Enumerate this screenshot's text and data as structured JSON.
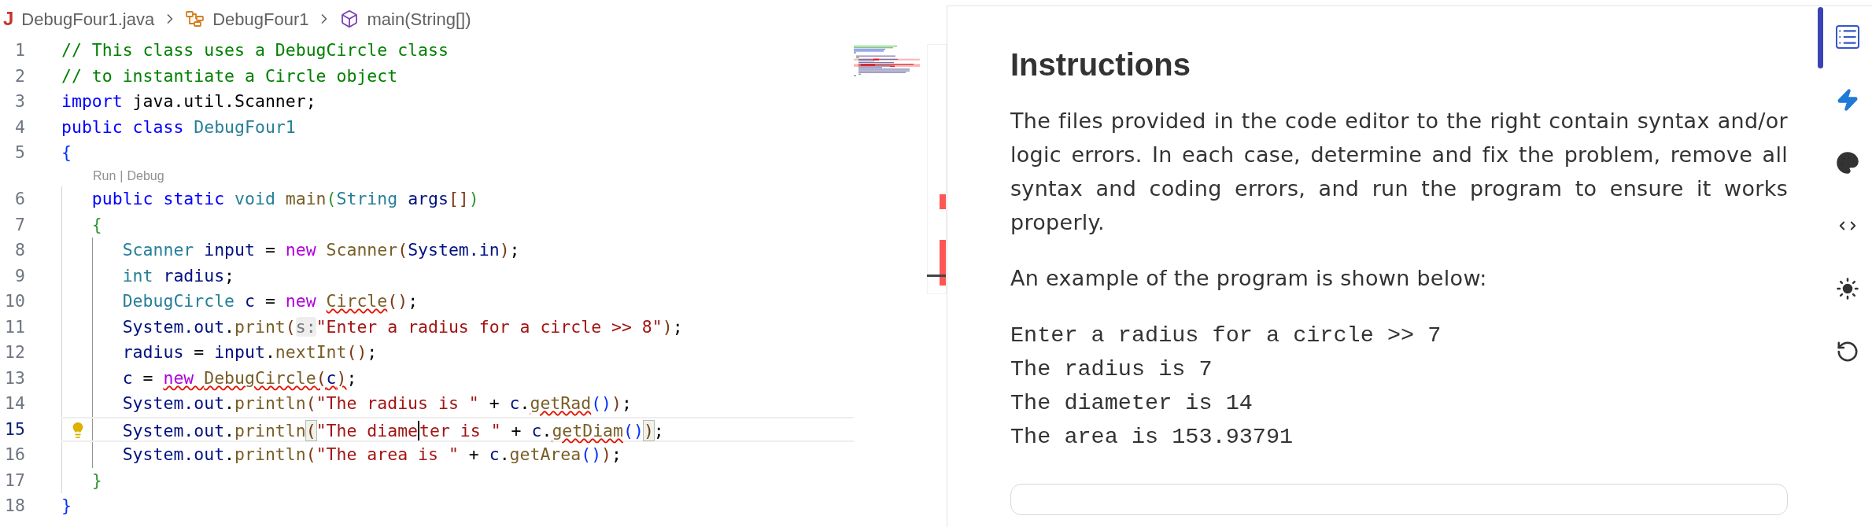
{
  "breadcrumb": [
    {
      "kind": "file",
      "icon_glyph": "J",
      "label": "DebugFour1.java"
    },
    {
      "kind": "class",
      "label": "DebugFour1"
    },
    {
      "kind": "method",
      "label": "main(String[])"
    }
  ],
  "editor": {
    "lines": [
      {
        "number": "1",
        "selected": false,
        "lightbulb": false,
        "tokens": [
          {
            "text": "// This class uses a DebugCircle class",
            "kind": "comment",
            "error": false,
            "matched": false,
            "caret": false
          }
        ]
      },
      {
        "number": "2",
        "selected": false,
        "lightbulb": false,
        "tokens": [
          {
            "text": "// to instantiate a Circle object",
            "kind": "comment",
            "error": false,
            "matched": false,
            "caret": false
          }
        ]
      },
      {
        "number": "3",
        "selected": false,
        "lightbulb": false,
        "tokens": [
          {
            "text": "import",
            "kind": "keyword",
            "error": false,
            "matched": false,
            "caret": false
          },
          {
            "text": " java.util.Scanner;",
            "kind": "plain",
            "error": false,
            "matched": false,
            "caret": false
          }
        ]
      },
      {
        "number": "4",
        "selected": false,
        "lightbulb": false,
        "tokens": [
          {
            "text": "public class ",
            "kind": "keyword",
            "error": false,
            "matched": false,
            "caret": false
          },
          {
            "text": "DebugFour1",
            "kind": "type",
            "error": false,
            "matched": false,
            "caret": false
          }
        ]
      },
      {
        "number": "5",
        "selected": false,
        "lightbulb": false,
        "tokens": [
          {
            "text": "{",
            "kind": "bracket1",
            "error": false,
            "matched": false,
            "caret": false
          }
        ]
      },
      {
        "number": "6",
        "selected": false,
        "lightbulb": false,
        "codelens": {
          "items": [
            "Run",
            "Debug"
          ],
          "separator": "|"
        },
        "tokens": [
          {
            "text": "   public static ",
            "kind": "keyword",
            "error": false,
            "matched": false,
            "caret": false
          },
          {
            "text": "void ",
            "kind": "type",
            "error": false,
            "matched": false,
            "caret": false
          },
          {
            "text": "main",
            "kind": "function",
            "error": false,
            "matched": false,
            "caret": false
          },
          {
            "text": "(",
            "kind": "bracket2",
            "error": false,
            "matched": false,
            "caret": false
          },
          {
            "text": "String ",
            "kind": "type",
            "error": false,
            "matched": false,
            "caret": false
          },
          {
            "text": "args",
            "kind": "variable",
            "error": false,
            "matched": false,
            "caret": false
          },
          {
            "text": "[]",
            "kind": "bracket3",
            "error": false,
            "matched": false,
            "caret": false
          },
          {
            "text": ")",
            "kind": "bracket2",
            "error": false,
            "matched": false,
            "caret": false
          }
        ]
      },
      {
        "number": "7",
        "selected": false,
        "lightbulb": false,
        "tokens": [
          {
            "text": "   {",
            "kind": "bracket2",
            "error": false,
            "matched": false,
            "caret": false
          }
        ]
      },
      {
        "number": "8",
        "selected": false,
        "lightbulb": false,
        "tokens": [
          {
            "text": "      Scanner ",
            "kind": "type",
            "error": false,
            "matched": false,
            "caret": false
          },
          {
            "text": "input",
            "kind": "variable",
            "error": false,
            "matched": false,
            "caret": false
          },
          {
            "text": " = ",
            "kind": "plain",
            "error": false,
            "matched": false,
            "caret": false
          },
          {
            "text": "new ",
            "kind": "control",
            "error": false,
            "matched": false,
            "caret": false
          },
          {
            "text": "Scanner",
            "kind": "function",
            "error": false,
            "matched": false,
            "caret": false
          },
          {
            "text": "(",
            "kind": "bracket3",
            "error": false,
            "matched": false,
            "caret": false
          },
          {
            "text": "System.in",
            "kind": "variable",
            "error": false,
            "matched": false,
            "caret": false
          },
          {
            "text": ")",
            "kind": "bracket3",
            "error": false,
            "matched": false,
            "caret": false
          },
          {
            "text": ";",
            "kind": "plain",
            "error": false,
            "matched": false,
            "caret": false
          }
        ]
      },
      {
        "number": "9",
        "selected": false,
        "lightbulb": false,
        "tokens": [
          {
            "text": "      int ",
            "kind": "type",
            "error": false,
            "matched": false,
            "caret": false
          },
          {
            "text": "radius",
            "kind": "variable",
            "error": false,
            "matched": false,
            "caret": false
          },
          {
            "text": ";",
            "kind": "plain",
            "error": false,
            "matched": false,
            "caret": false
          }
        ]
      },
      {
        "number": "10",
        "selected": false,
        "lightbulb": false,
        "tokens": [
          {
            "text": "      DebugCircle ",
            "kind": "type",
            "error": false,
            "matched": false,
            "caret": false
          },
          {
            "text": "c",
            "kind": "variable",
            "error": false,
            "matched": false,
            "caret": false
          },
          {
            "text": " = ",
            "kind": "plain",
            "error": false,
            "matched": false,
            "caret": false
          },
          {
            "text": "new ",
            "kind": "control",
            "error": false,
            "matched": false,
            "caret": false
          },
          {
            "text": "Circle",
            "kind": "function",
            "error": true,
            "matched": false,
            "caret": false
          },
          {
            "text": "()",
            "kind": "bracket3",
            "error": false,
            "matched": false,
            "caret": false
          },
          {
            "text": ";",
            "kind": "plain",
            "error": false,
            "matched": false,
            "caret": false
          }
        ]
      },
      {
        "number": "11",
        "selected": false,
        "lightbulb": false,
        "tokens": [
          {
            "text": "      System.out",
            "kind": "variable",
            "error": false,
            "matched": false,
            "caret": false
          },
          {
            "text": ".",
            "kind": "plain",
            "error": false,
            "matched": false,
            "caret": false
          },
          {
            "text": "print",
            "kind": "function",
            "error": false,
            "matched": false,
            "caret": false
          },
          {
            "text": "(",
            "kind": "bracket3",
            "error": false,
            "matched": false,
            "caret": false
          },
          {
            "text": "s:",
            "kind": "hint",
            "error": false,
            "matched": false,
            "caret": false
          },
          {
            "text": "\"Enter a radius for a circle >> 8\"",
            "kind": "string",
            "error": false,
            "matched": false,
            "caret": false
          },
          {
            "text": ")",
            "kind": "bracket3",
            "error": false,
            "matched": false,
            "caret": false
          },
          {
            "text": ";",
            "kind": "plain",
            "error": false,
            "matched": false,
            "caret": false
          }
        ]
      },
      {
        "number": "12",
        "selected": false,
        "lightbulb": false,
        "tokens": [
          {
            "text": "      radius",
            "kind": "variable",
            "error": false,
            "matched": false,
            "caret": false
          },
          {
            "text": " = ",
            "kind": "plain",
            "error": false,
            "matched": false,
            "caret": false
          },
          {
            "text": "input",
            "kind": "variable",
            "error": false,
            "matched": false,
            "caret": false
          },
          {
            "text": ".",
            "kind": "plain",
            "error": false,
            "matched": false,
            "caret": false
          },
          {
            "text": "nextInt",
            "kind": "function",
            "error": false,
            "matched": false,
            "caret": false
          },
          {
            "text": "()",
            "kind": "bracket3",
            "error": false,
            "matched": false,
            "caret": false
          },
          {
            "text": ";",
            "kind": "plain",
            "error": false,
            "matched": false,
            "caret": false
          }
        ]
      },
      {
        "number": "13",
        "selected": false,
        "lightbulb": false,
        "tokens": [
          {
            "text": "      c",
            "kind": "variable",
            "error": false,
            "matched": false,
            "caret": false
          },
          {
            "text": " = ",
            "kind": "plain",
            "error": false,
            "matched": false,
            "caret": false
          },
          {
            "text": "new ",
            "kind": "control",
            "error": true,
            "matched": false,
            "caret": false
          },
          {
            "text": "DebugCircle",
            "kind": "function",
            "error": true,
            "matched": false,
            "caret": false
          },
          {
            "text": "(",
            "kind": "bracket3",
            "error": true,
            "matched": false,
            "caret": false
          },
          {
            "text": "c",
            "kind": "variable",
            "error": true,
            "matched": false,
            "caret": false
          },
          {
            "text": ")",
            "kind": "bracket3",
            "error": true,
            "matched": false,
            "caret": false
          },
          {
            "text": ";",
            "kind": "plain",
            "error": false,
            "matched": false,
            "caret": false
          }
        ]
      },
      {
        "number": "14",
        "selected": false,
        "lightbulb": false,
        "tokens": [
          {
            "text": "      System.out",
            "kind": "variable",
            "error": false,
            "matched": false,
            "caret": false
          },
          {
            "text": ".",
            "kind": "plain",
            "error": false,
            "matched": false,
            "caret": false
          },
          {
            "text": "println",
            "kind": "function",
            "error": false,
            "matched": false,
            "caret": false
          },
          {
            "text": "(",
            "kind": "bracket3",
            "error": false,
            "matched": false,
            "caret": false
          },
          {
            "text": "\"The radius is \"",
            "kind": "string",
            "error": false,
            "matched": false,
            "caret": false
          },
          {
            "text": " + ",
            "kind": "plain",
            "error": false,
            "matched": false,
            "caret": false
          },
          {
            "text": "c",
            "kind": "variable",
            "error": false,
            "matched": false,
            "caret": false
          },
          {
            "text": ".",
            "kind": "plain",
            "error": false,
            "matched": false,
            "caret": false
          },
          {
            "text": "getRad",
            "kind": "function",
            "error": true,
            "matched": false,
            "caret": false
          },
          {
            "text": "()",
            "kind": "bracket1",
            "error": false,
            "matched": false,
            "caret": false
          },
          {
            "text": ")",
            "kind": "bracket3",
            "error": false,
            "matched": false,
            "caret": false
          },
          {
            "text": ";",
            "kind": "plain",
            "error": false,
            "matched": false,
            "caret": false
          }
        ]
      },
      {
        "number": "15",
        "selected": true,
        "lightbulb": true,
        "tokens": [
          {
            "text": "      System.out",
            "kind": "variable",
            "error": false,
            "matched": false,
            "caret": false
          },
          {
            "text": ".",
            "kind": "plain",
            "error": false,
            "matched": false,
            "caret": false
          },
          {
            "text": "println",
            "kind": "function",
            "error": false,
            "matched": false,
            "caret": false
          },
          {
            "text": "(",
            "kind": "bracket3",
            "error": false,
            "matched": true,
            "caret": false
          },
          {
            "text": "\"The diame",
            "kind": "string",
            "error": false,
            "matched": false,
            "caret": true
          },
          {
            "text": "ter is \"",
            "kind": "string",
            "error": false,
            "matched": false,
            "caret": false
          },
          {
            "text": " + ",
            "kind": "plain",
            "error": false,
            "matched": false,
            "caret": false
          },
          {
            "text": "c",
            "kind": "variable",
            "error": false,
            "matched": false,
            "caret": false
          },
          {
            "text": ".",
            "kind": "plain",
            "error": false,
            "matched": false,
            "caret": false
          },
          {
            "text": "getDiam",
            "kind": "function",
            "error": true,
            "matched": false,
            "caret": false
          },
          {
            "text": "()",
            "kind": "bracket1",
            "error": false,
            "matched": false,
            "caret": false
          },
          {
            "text": ")",
            "kind": "bracket3",
            "error": false,
            "matched": true,
            "caret": false
          },
          {
            "text": ";",
            "kind": "plain",
            "error": false,
            "matched": false,
            "caret": false
          }
        ]
      },
      {
        "number": "16",
        "selected": false,
        "lightbulb": false,
        "tokens": [
          {
            "text": "      System.out",
            "kind": "variable",
            "error": false,
            "matched": false,
            "caret": false
          },
          {
            "text": ".",
            "kind": "plain",
            "error": false,
            "matched": false,
            "caret": false
          },
          {
            "text": "println",
            "kind": "function",
            "error": false,
            "matched": false,
            "caret": false
          },
          {
            "text": "(",
            "kind": "bracket3",
            "error": false,
            "matched": false,
            "caret": false
          },
          {
            "text": "\"The area is \"",
            "kind": "string",
            "error": false,
            "matched": false,
            "caret": false
          },
          {
            "text": " + ",
            "kind": "plain",
            "error": false,
            "matched": false,
            "caret": false
          },
          {
            "text": "c",
            "kind": "variable",
            "error": false,
            "matched": false,
            "caret": false
          },
          {
            "text": ".",
            "kind": "plain",
            "error": false,
            "matched": false,
            "caret": false
          },
          {
            "text": "getArea",
            "kind": "function",
            "error": false,
            "matched": false,
            "caret": false
          },
          {
            "text": "()",
            "kind": "bracket1",
            "error": false,
            "matched": false,
            "caret": false
          },
          {
            "text": ")",
            "kind": "bracket3",
            "error": false,
            "matched": false,
            "caret": false
          },
          {
            "text": ";",
            "kind": "plain",
            "error": false,
            "matched": false,
            "caret": false
          }
        ]
      },
      {
        "number": "17",
        "selected": false,
        "lightbulb": false,
        "tokens": [
          {
            "text": "   }",
            "kind": "bracket2",
            "error": false,
            "matched": false,
            "caret": false
          }
        ]
      },
      {
        "number": "18",
        "selected": false,
        "lightbulb": false,
        "tokens": [
          {
            "text": "}",
            "kind": "bracket1",
            "error": false,
            "matched": false,
            "caret": false
          }
        ]
      }
    ]
  },
  "instructions": {
    "heading": "Instructions",
    "paragraphs": [
      "The files provided in the code editor to the right contain syntax and/or logic errors. In each case, determine and fix the problem, remove all syntax and coding errors, and run the program to ensure it works properly.",
      "An example of the program is shown below:"
    ],
    "example_output": [
      "Enter a radius for a circle >> 7",
      "The radius is 7",
      "The diameter is 14",
      "The area is 153.93791"
    ]
  },
  "side_toolbar": [
    {
      "kind": "list",
      "selected": true
    },
    {
      "kind": "bolt",
      "selected": false
    },
    {
      "kind": "palette",
      "selected": false
    },
    {
      "kind": "code",
      "selected": false
    },
    {
      "kind": "sun",
      "selected": false
    },
    {
      "kind": "reset",
      "selected": false
    }
  ]
}
